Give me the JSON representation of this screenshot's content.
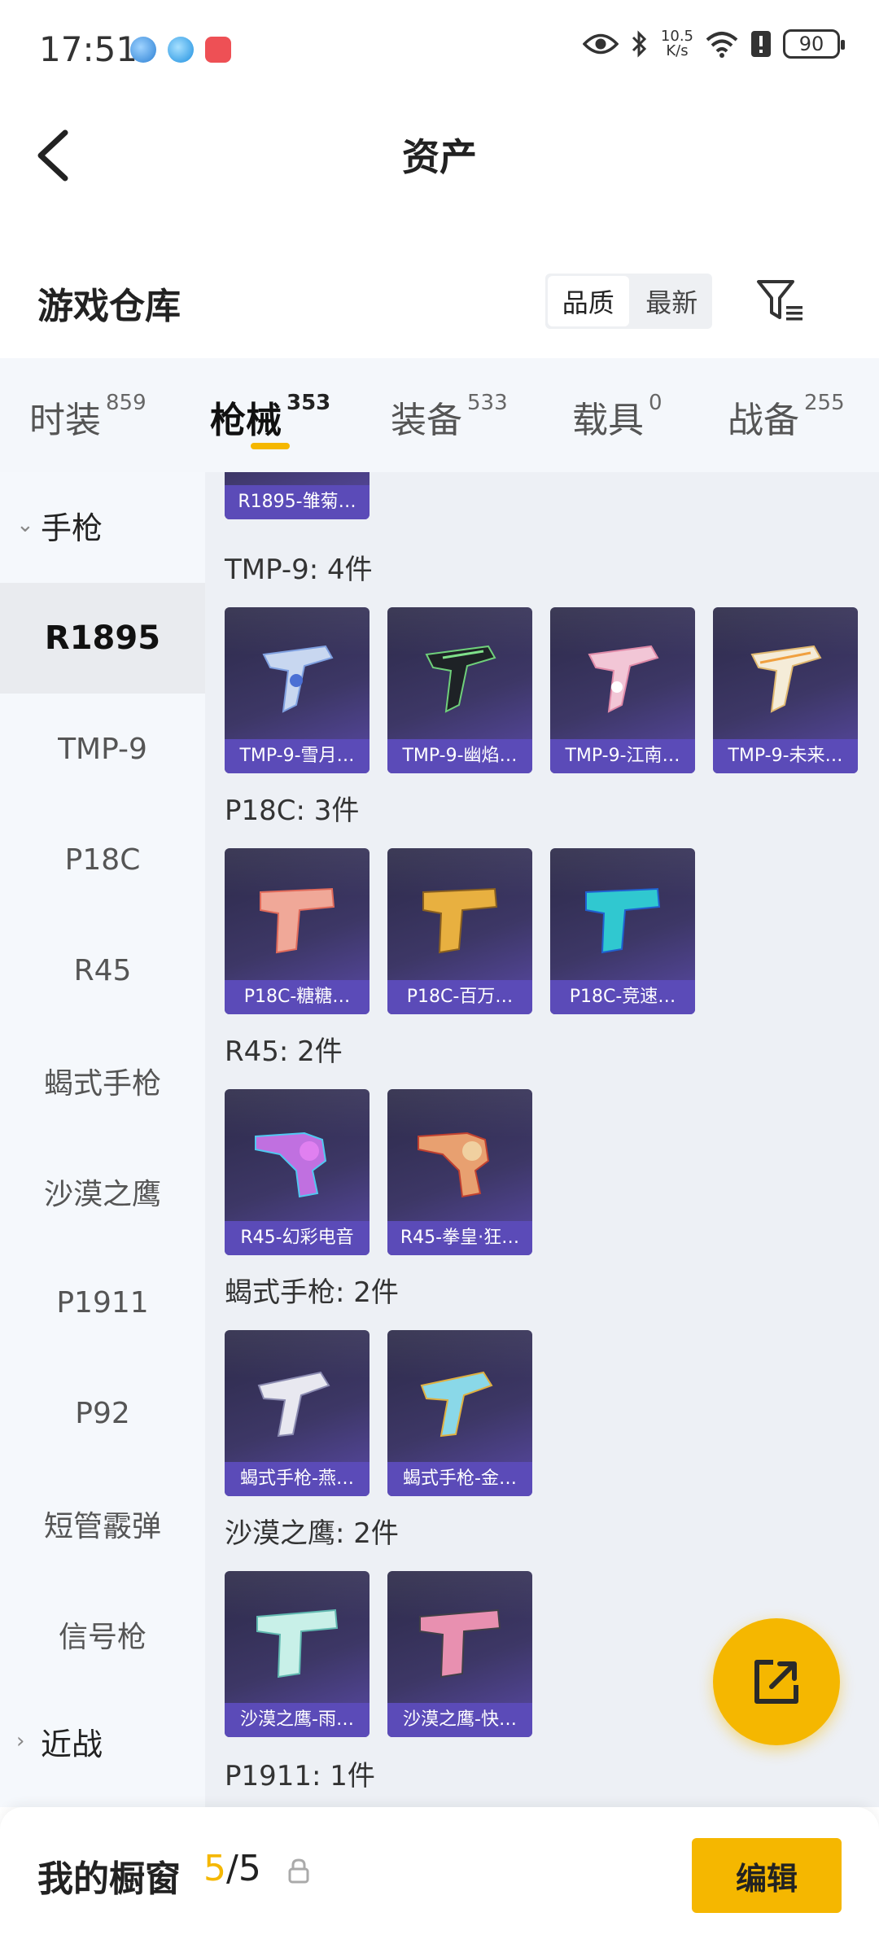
{
  "status_bar": {
    "time": "17:51",
    "speed_value": "10.5",
    "speed_unit": "K/s",
    "battery": "90"
  },
  "header": {
    "title": "资产"
  },
  "section": {
    "title": "游戏仓库",
    "sort_options": [
      "品质",
      "最新"
    ],
    "sort_selected": "品质"
  },
  "tabs": [
    {
      "label": "时装",
      "count": "859"
    },
    {
      "label": "枪械",
      "count": "353",
      "active": true
    },
    {
      "label": "装备",
      "count": "533"
    },
    {
      "label": "载具",
      "count": "0"
    },
    {
      "label": "战备",
      "count": "255"
    }
  ],
  "sidebar": {
    "group_pistol": "手枪",
    "items": [
      "R1895",
      "TMP-9",
      "P18C",
      "R45",
      "蝎式手枪",
      "沙漠之鹰",
      "P1911",
      "P92",
      "短管霰弹",
      "信号枪"
    ],
    "active_item": "R1895",
    "group_melee": "近战"
  },
  "content": {
    "top_partial_card": "R1895-雏菊…",
    "groups": [
      {
        "label": "TMP-9: 4件",
        "cards": [
          "TMP-9-雪月…",
          "TMP-9-幽焰…",
          "TMP-9-江南…",
          "TMP-9-未来…"
        ]
      },
      {
        "label": "P18C: 3件",
        "cards": [
          "P18C-糖糖…",
          "P18C-百万…",
          "P18C-竞速…"
        ]
      },
      {
        "label": "R45: 2件",
        "cards": [
          "R45-幻彩电音",
          "R45-拳皇·狂…"
        ]
      },
      {
        "label": "蝎式手枪: 2件",
        "cards": [
          "蝎式手枪-燕…",
          "蝎式手枪-金…"
        ]
      },
      {
        "label": "沙漠之鹰: 2件",
        "cards": [
          "沙漠之鹰-雨…",
          "沙漠之鹰-快…"
        ]
      },
      {
        "label": "P1911: 1件",
        "cards": []
      }
    ]
  },
  "bottom_bar": {
    "label": "我的橱窗",
    "current": "5",
    "total": "/5",
    "edit_label": "编辑"
  },
  "colors": {
    "accent": "#f5b700",
    "card_caption": "#5b4bb8",
    "card_bg": "#3d3766"
  }
}
